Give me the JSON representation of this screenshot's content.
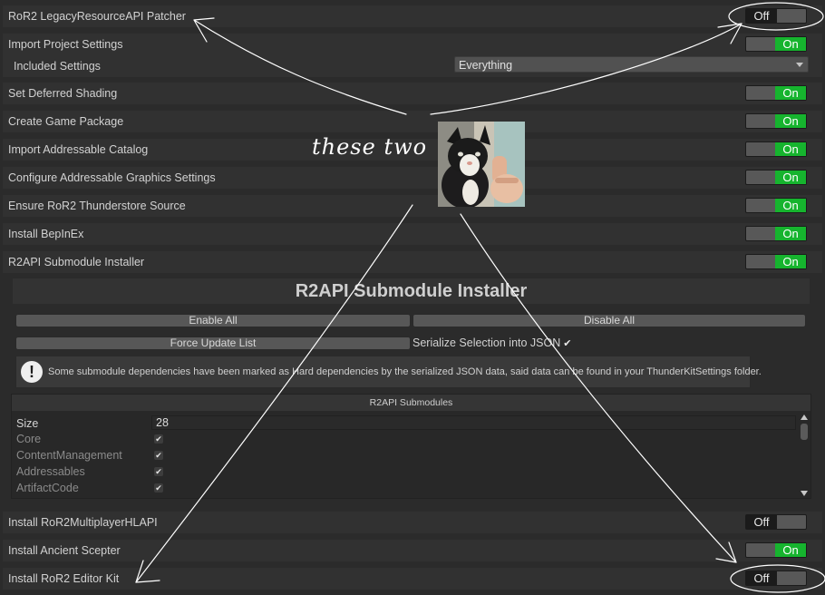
{
  "rows": [
    {
      "label": "RoR2 LegacyResourceAPI Patcher",
      "state": "Off"
    },
    {
      "label": "Import Project Settings",
      "state": "On"
    },
    {
      "label": "Set Deferred Shading",
      "state": "On"
    },
    {
      "label": "Create Game Package",
      "state": "On"
    },
    {
      "label": "Import Addressable Catalog",
      "state": "On"
    },
    {
      "label": "Configure Addressable Graphics Settings",
      "state": "On"
    },
    {
      "label": "Ensure RoR2 Thunderstore Source",
      "state": "On"
    },
    {
      "label": "Install BepInEx",
      "state": "On"
    },
    {
      "label": "R2API Submodule Installer",
      "state": "On"
    },
    {
      "label": "Install RoR2MultiplayerHLAPI",
      "state": "Off"
    },
    {
      "label": "Install Ancient Scepter",
      "state": "On"
    },
    {
      "label": "Install RoR2 Editor Kit",
      "state": "Off"
    }
  ],
  "included_settings": {
    "label": "Included Settings",
    "value": "Everything"
  },
  "installer": {
    "title": "R2API Submodule Installer",
    "enable_all": "Enable All",
    "disable_all": "Disable All",
    "force_update": "Force Update List",
    "serialize": "Serialize Selection into JSON",
    "serialize_checked": true,
    "help_icon": "!",
    "help_text": "Some submodule dependencies have been marked as Hard dependencies by the serialized JSON data, said data can be found in your ThunderKitSettings folder.",
    "list_header": "R2API Submodules",
    "size_label": "Size",
    "size_value": "28",
    "submodules": [
      {
        "name": "Core",
        "checked": true
      },
      {
        "name": "ContentManagement",
        "checked": true
      },
      {
        "name": "Addressables",
        "checked": true
      },
      {
        "name": "ArtifactCode",
        "checked": true
      }
    ]
  },
  "annotation": {
    "text": "these two"
  },
  "colors": {
    "on": "#16b42e",
    "background": "#2b2b2b",
    "row": "#313131"
  },
  "icons": {
    "help": "warning-icon",
    "checkmark": "checkmark-icon",
    "dropdown": "chevron-down-icon"
  }
}
